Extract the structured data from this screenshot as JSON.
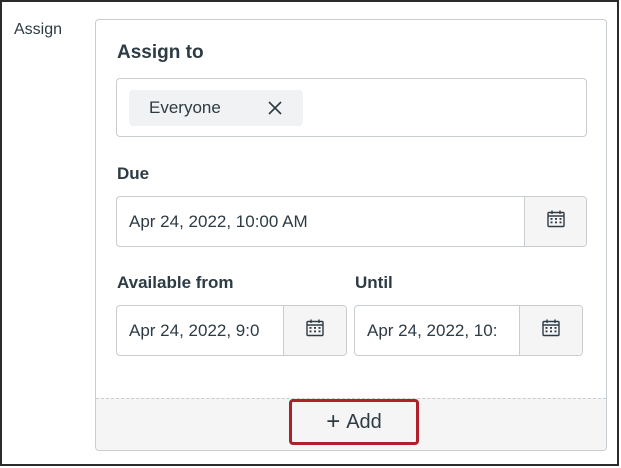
{
  "assign_label": "Assign",
  "card": {
    "title": "Assign to",
    "assignees": [
      {
        "label": "Everyone"
      }
    ],
    "due": {
      "label": "Due",
      "value": "Apr 24, 2022, 10:00 AM"
    },
    "available_from": {
      "label": "Available from",
      "value": "Apr 24, 2022, 9:0"
    },
    "until": {
      "label": "Until",
      "value": "Apr 24, 2022, 10:"
    },
    "add_button": {
      "plus": "+",
      "label": "Add"
    }
  },
  "colors": {
    "text": "#2d3b45",
    "border": "#c7cdd1",
    "chip_bg": "#f0f2f3",
    "button_bg": "#f5f5f5",
    "highlight": "#b0202a"
  },
  "icons": {
    "chip_remove": "close-icon",
    "date_picker": "calendar-icon"
  }
}
